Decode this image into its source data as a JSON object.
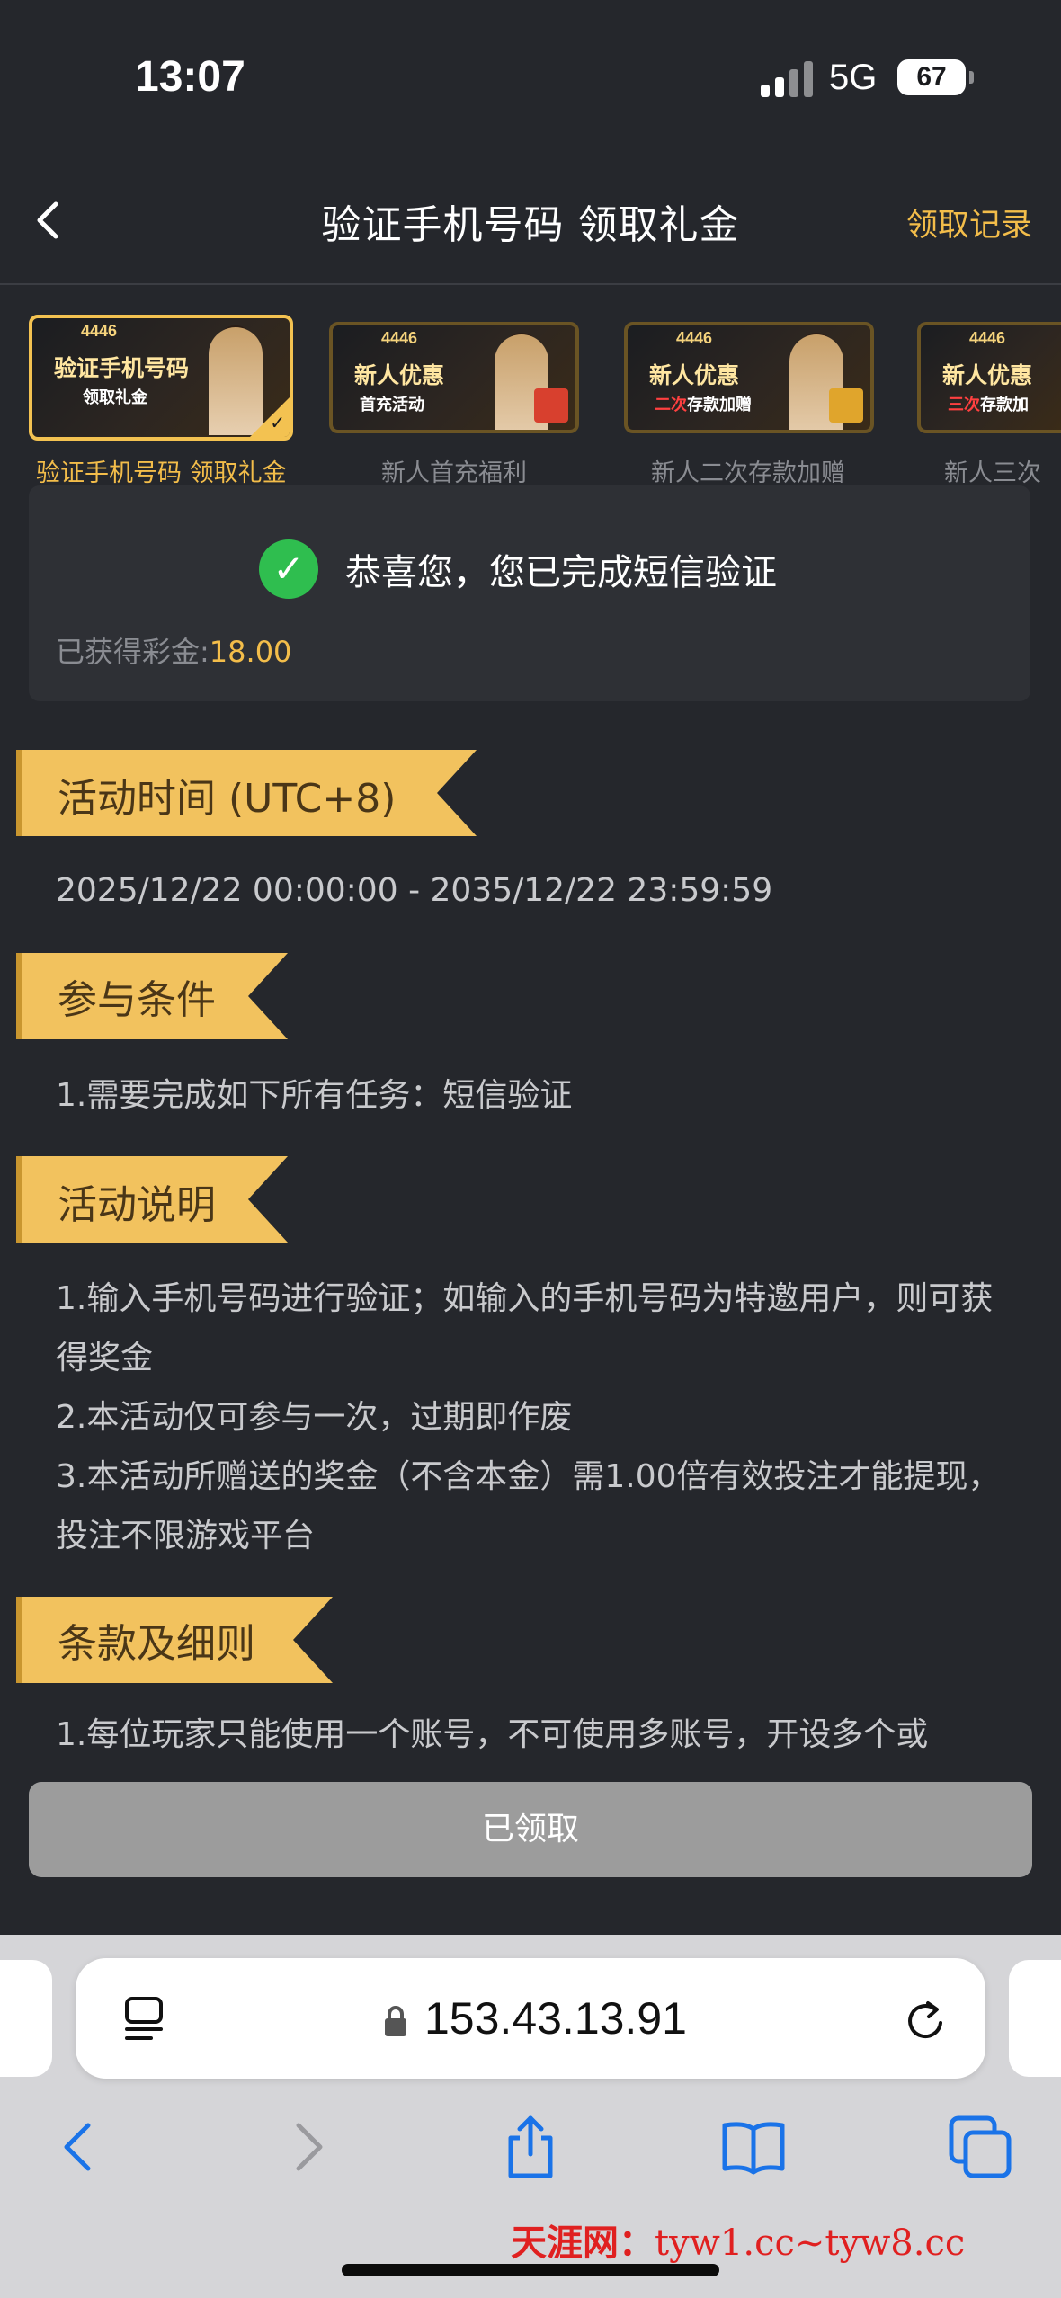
{
  "status_bar": {
    "time": "13:07",
    "network": "5G",
    "battery": "67"
  },
  "header": {
    "title": "验证手机号码 领取礼金",
    "records": "领取记录"
  },
  "promos": [
    {
      "badge": "4446",
      "title": "验证手机号码",
      "subtitle": "领取礼金",
      "label": "验证手机号码 领取礼金",
      "active": true
    },
    {
      "badge": "4446",
      "title": "新人优惠",
      "subtitle": "首充活动",
      "label": "新人首充福利",
      "active": false
    },
    {
      "badge": "4446",
      "title": "新人优惠",
      "subtitle_red": "二次",
      "subtitle": "存款加赠",
      "label": "新人二次存款加赠",
      "active": false
    },
    {
      "badge": "4446",
      "title": "新人优惠",
      "subtitle_red": "三次",
      "subtitle": "存款加",
      "label": "新人三次",
      "active": false
    }
  ],
  "success": {
    "message": "恭喜您，您已完成短信验证",
    "bonus_label": "已获得彩金:",
    "bonus_value": "18.00"
  },
  "sections": {
    "time": {
      "title": "活动时间 (UTC+8)",
      "body": "2025/12/22 00:00:00 - 2035/12/22 23:59:59"
    },
    "conditions": {
      "title": "参与条件",
      "body": "1.需要完成如下所有任务：短信验证"
    },
    "description": {
      "title": "活动说明",
      "lines": [
        "1.输入手机号码进行验证；如输入的手机号码为特邀用户，则可获得奖金",
        "2.本活动仅可参与一次，过期即作废",
        "3.本活动所赠送的奖金（不含本金）需1.00倍有效投注才能提现，投注不限游戏平台"
      ]
    },
    "terms": {
      "title": "条款及细则",
      "body": "1.每位玩家只能使用一个账号，不可使用多账号，开设多个或"
    }
  },
  "claim_button": "已领取",
  "browser": {
    "url": "153.43.13.91"
  },
  "watermark": {
    "brand": "天涯网：",
    "domains": "tyw1.cc~tyw8.cc"
  }
}
